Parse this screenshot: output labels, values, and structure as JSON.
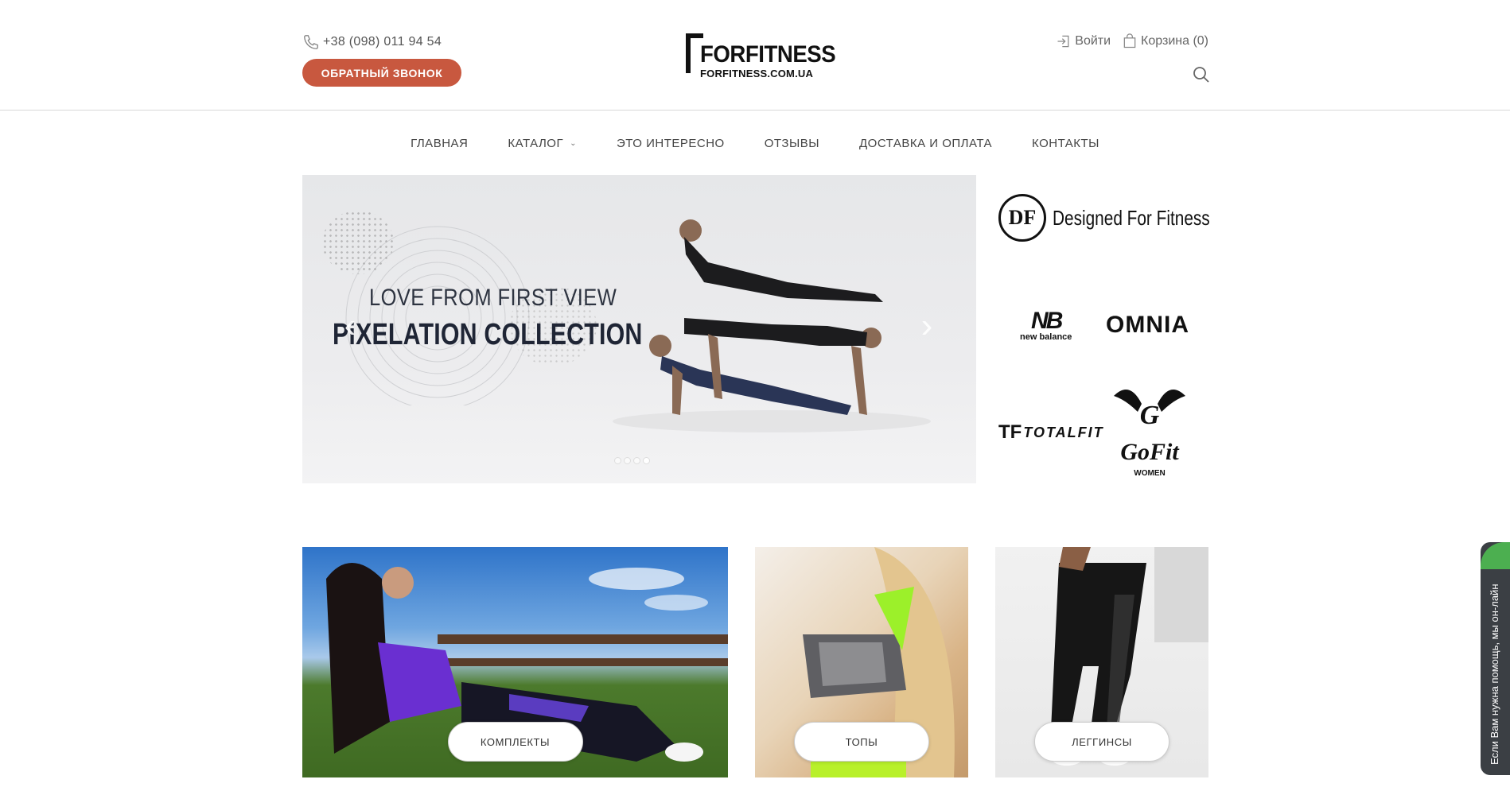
{
  "header": {
    "phone": "+38 (098) 011 94 54",
    "callback_label": "ОБРАТНЫЙ ЗВОНОК",
    "logo_name": "FORFITNESS",
    "logo_domain": "FORFITNESS.COM.UA",
    "login_label": "Войти",
    "cart_label": "Корзина (0)"
  },
  "nav": {
    "items": [
      "ГЛАВНАЯ",
      "КАТАЛОГ",
      "ЭТО ИНТЕРЕСНО",
      "ОТЗЫВЫ",
      "ДОСТАВКА И ОПЛАТА",
      "КОНТАКТЫ"
    ]
  },
  "slider": {
    "line1": "LOVE FROM FIRST VIEW",
    "line2": "PiXELATION COLLECTION",
    "slides": 4,
    "active_slide": 3
  },
  "brands": {
    "df_mark": "DF",
    "df_name": "Designed For Fitness",
    "nb_sub": "new balance",
    "omnia": "OMNIA",
    "totalfit": "TOTALFIT",
    "gofit": "GoFit",
    "gofit_sub": "WOMEN"
  },
  "categories": [
    {
      "label": "КОМПЛЕКТЫ"
    },
    {
      "label": "ТОПЫ"
    },
    {
      "label": "ЛЕГГИНСЫ"
    }
  ],
  "chat": {
    "text": "Если Вам нужна помощь, мы он-лайн"
  },
  "colors": {
    "accent": "#c8583f",
    "chat_bg": "#3b3f44",
    "chat_online": "#4caf50"
  }
}
